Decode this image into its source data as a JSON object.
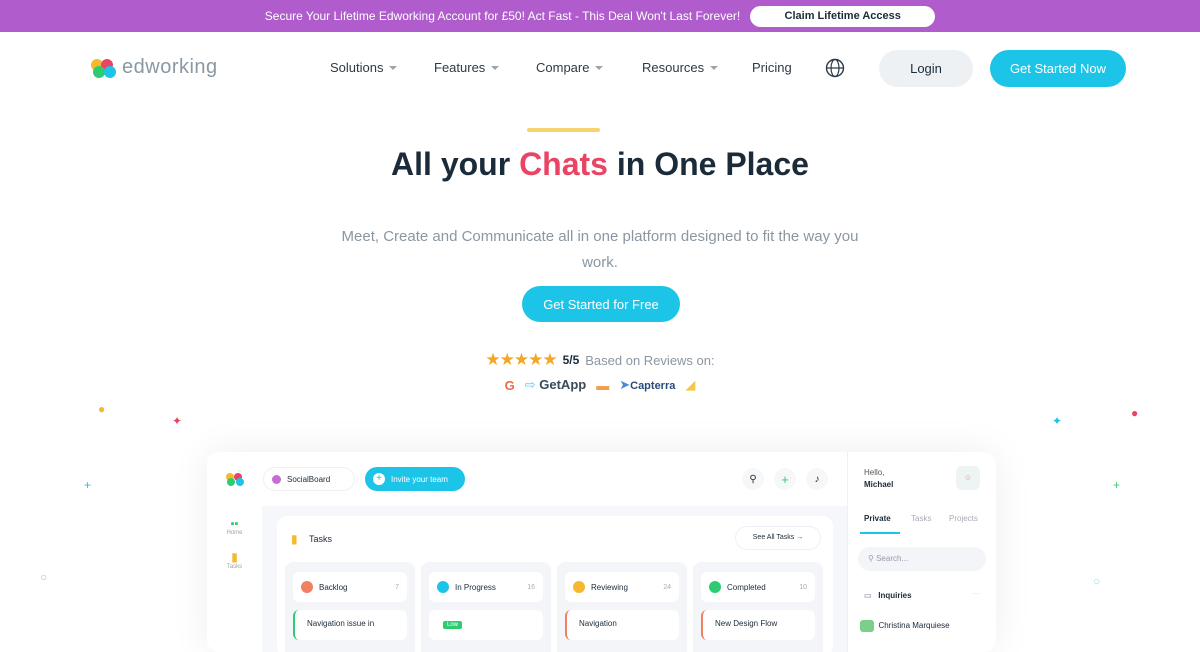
{
  "banner": {
    "text": "Secure Your Lifetime Edworking Account for £50! Act Fast - This Deal Won't Last Forever!",
    "button": "Claim Lifetime Access"
  },
  "header": {
    "logo": "edworking",
    "nav": [
      "Solutions",
      "Features",
      "Compare",
      "Resources",
      "Pricing"
    ],
    "login": "Login",
    "get_started": "Get Started Now"
  },
  "hero": {
    "title_before": "All your",
    "rotating_word": "Chats",
    "title_after": "in One Place",
    "subtitle": "Meet, Create and Communicate all in one platform designed to fit the way you work.",
    "cta": "Get Started for Free",
    "stars": "★★★★★",
    "rating": "5/5",
    "rating_text": "Based on Reviews on:",
    "review_sites": [
      "GetApp",
      "Capterra"
    ]
  },
  "colors": {
    "banner": "#b05ccc",
    "accent": "#1cc4e8",
    "rotating": "#ea4464",
    "text": "#1b2b3a"
  },
  "dashboard": {
    "workspace": "SocialBoard",
    "invite": "Invite your team",
    "sidebar": [
      "Home",
      "Tasks"
    ],
    "tasks_title": "Tasks",
    "see_all": "See All Tasks →",
    "columns": [
      {
        "name": "Backlog",
        "count": "7",
        "card": "Navigation issue in",
        "color": "#f08060"
      },
      {
        "name": "In Progress",
        "count": "16",
        "card": "Low",
        "color": "#1cc4e8"
      },
      {
        "name": "Reviewing",
        "count": "24",
        "card": "Navigation",
        "color": "#f5b82e"
      },
      {
        "name": "Completed",
        "count": "10",
        "card": "New Design Flow",
        "color": "#2ecc71"
      }
    ],
    "right": {
      "hello": "Hello,",
      "user": "Michael",
      "tabs": [
        "Private",
        "Tasks",
        "Projects"
      ],
      "search_placeholder": "Search...",
      "inquiries": "Inquiries",
      "contact": "Christina Marquiese"
    }
  }
}
